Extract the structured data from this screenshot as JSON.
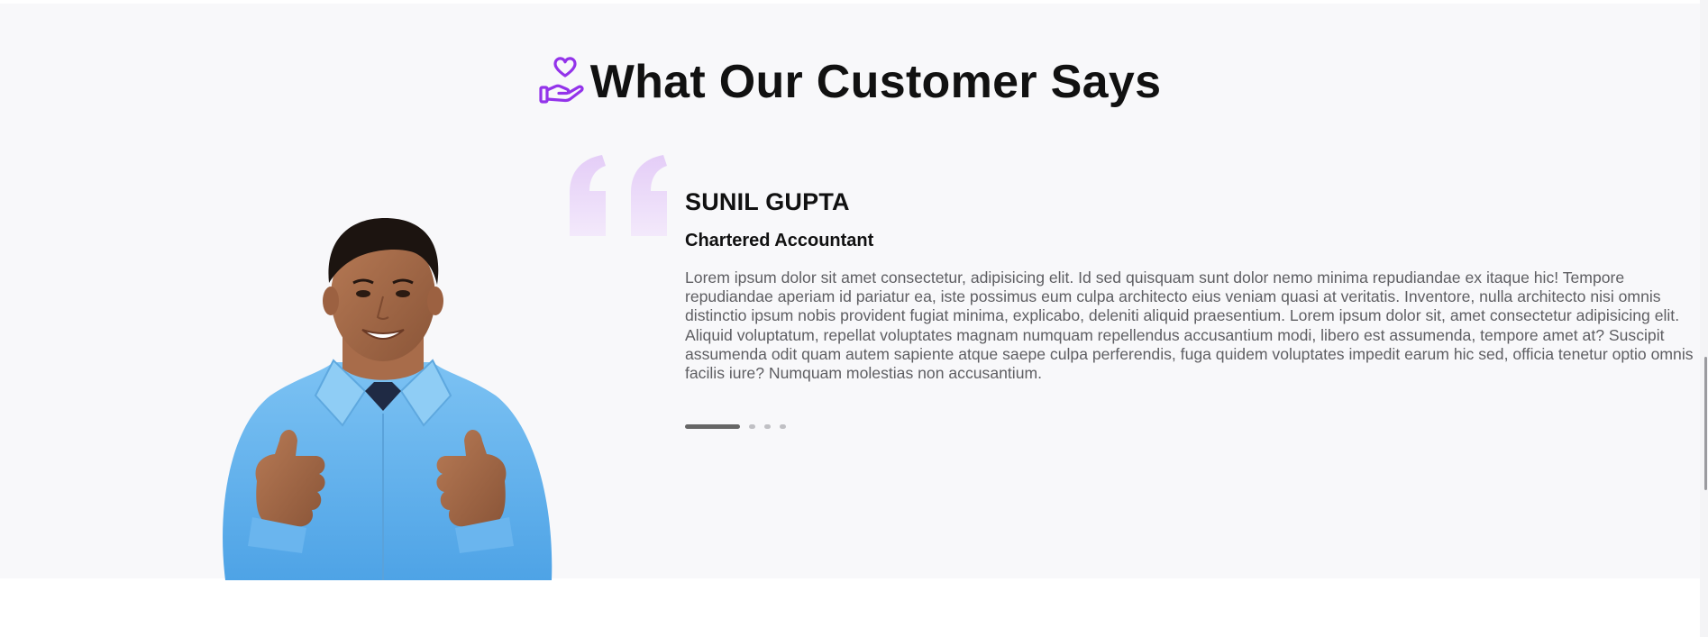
{
  "section": {
    "title": "What Our Customer Says",
    "title_icon": "hand-heart-icon"
  },
  "testimonial": {
    "name": "SUNIL GUPTA",
    "role": "Chartered Accountant",
    "text": "Lorem ipsum dolor sit amet consectetur, adipisicing elit. Id sed quisquam sunt dolor nemo minima repudiandae ex itaque hic! Tempore repudiandae aperiam id pariatur ea, iste possimus eum culpa architecto eius veniam quasi at veritatis. Inventore, nulla architecto nisi omnis distinctio ipsum nobis provident fugiat minima, explicabo, deleniti aliquid praesentium. Lorem ipsum dolor sit, amet consectetur adipisicing elit. Aliquid voluptatum, repellat voluptates magnam numquam repellendus accusantium modi, libero est assumenda, tempore amet at? Suscipit assumenda odit quam autem sapiente atque saepe culpa perferendis, fuga quidem voluptates impedit earum hic sed, officia tenetur optio omnis facilis iure? Numquam molestias non accusantium.",
    "photo": "smiling-man-thumbs-up-photo",
    "quote_icon": "quote-mark-icon"
  },
  "carousel": {
    "total_slides": 4,
    "active_slide": 1
  },
  "colors": {
    "accent": "#9333ea",
    "quote": "#ead7f8",
    "background": "#f8f8fa",
    "heading": "#111111",
    "body_text": "#5e5e62"
  }
}
